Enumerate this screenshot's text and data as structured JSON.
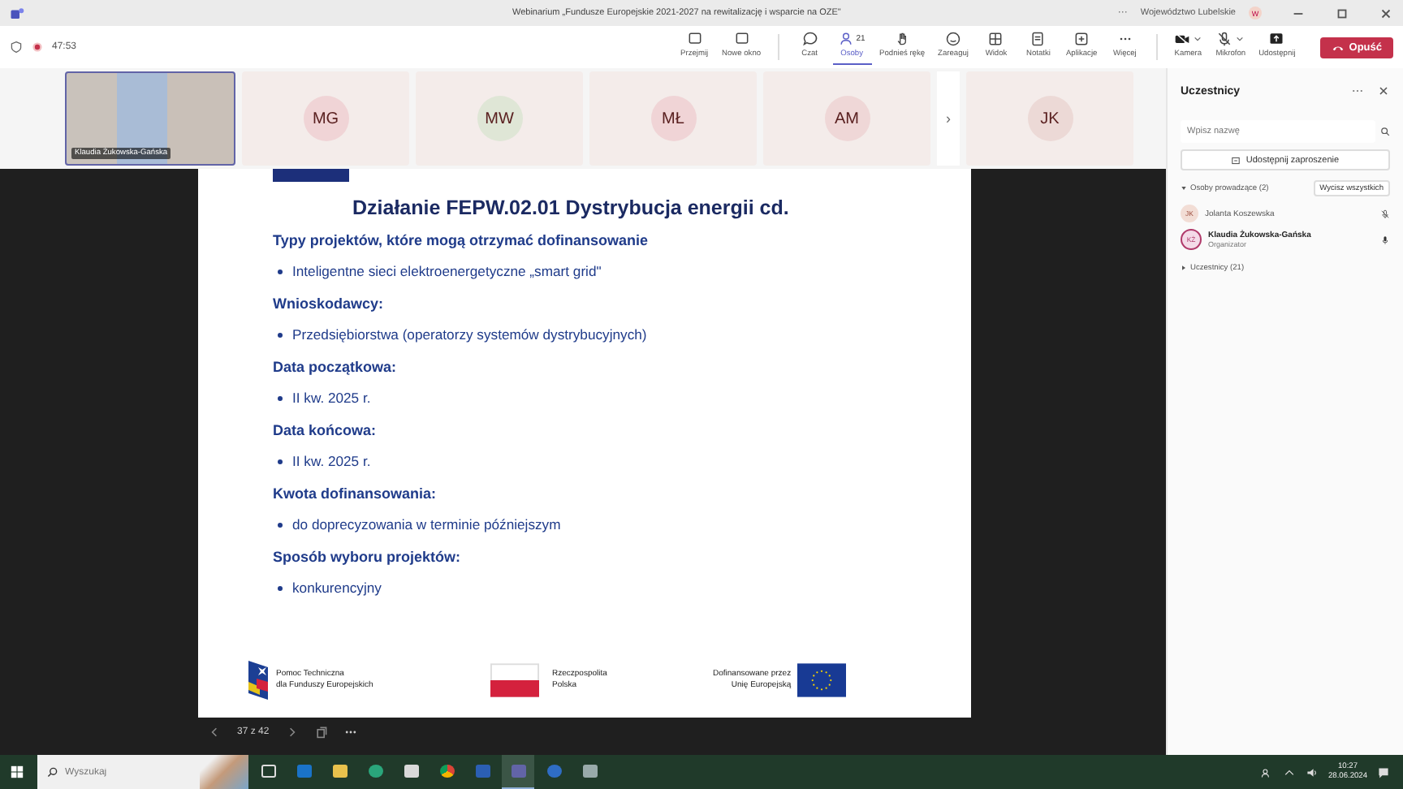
{
  "window": {
    "title": "Webinarium „Fundusze Europejskie 2021-2027 na rewitalizację i wsparcie na OZE\"",
    "more": "···",
    "organization": "Województwo Lubelskie",
    "user_initials": "W"
  },
  "meeting": {
    "timer": "47:53"
  },
  "toolbar": [
    {
      "kind": "tool",
      "label": "Przejmij",
      "selected": false
    },
    {
      "kind": "tool",
      "label": "Nowe okno",
      "selected": false
    },
    {
      "kind": "divider"
    },
    {
      "kind": "tool",
      "label": "Czat",
      "selected": false
    },
    {
      "kind": "tool",
      "label": "Osoby",
      "badge": "21",
      "selected": true
    },
    {
      "kind": "tool",
      "label": "Podnieś rękę",
      "selected": false
    },
    {
      "kind": "tool",
      "label": "Zareaguj",
      "selected": false
    },
    {
      "kind": "tool",
      "label": "Widok",
      "selected": false
    },
    {
      "kind": "tool",
      "label": "Notatki",
      "selected": false
    },
    {
      "kind": "tool",
      "label": "Aplikacje",
      "selected": false
    },
    {
      "kind": "tool",
      "label": "Więcej",
      "selected": false
    },
    {
      "kind": "divider"
    },
    {
      "kind": "device",
      "label": "Kamera",
      "selected": false
    },
    {
      "kind": "device",
      "label": "Mikrofon",
      "selected": false
    },
    {
      "kind": "tool",
      "label": "Udostępnij",
      "selected": false
    }
  ],
  "leave_button": "Opuść",
  "video_strip": [
    {
      "kind": "video",
      "name": "Klaudia Żukowska-Gańska"
    },
    {
      "kind": "avatar",
      "initials": "MG",
      "color": "#f0d4d6"
    },
    {
      "kind": "avatar",
      "initials": "MW",
      "color": "#dfe6d6"
    },
    {
      "kind": "avatar",
      "initials": "MŁ",
      "color": "#f0d4d6"
    },
    {
      "kind": "avatar",
      "initials": "AM",
      "color": "#efd7d7"
    },
    {
      "kind": "next",
      "glyph": "›"
    },
    {
      "kind": "avatar",
      "initials": "JK",
      "color": "#ecd9d6"
    }
  ],
  "slide": {
    "title": "Działanie FEPW.02.01 Dystrybucja energii cd.",
    "sections": [
      {
        "heading": "Typy projektów, które mogą otrzymać dofinansowanie",
        "items": [
          "Inteligentne sieci elektroenergetyczne „smart grid\""
        ]
      },
      {
        "heading": "Wnioskodawcy:",
        "items": [
          "Przedsiębiorstwa (operatorzy systemów dystrybucyjnych)"
        ]
      },
      {
        "heading": "Data początkowa:",
        "items": [
          "II kw. 2025 r."
        ]
      },
      {
        "heading": "Data końcowa:",
        "items": [
          "II kw. 2025 r."
        ]
      },
      {
        "heading": "Kwota dofinansowania:",
        "items": [
          "do doprecyzowania w terminie późniejszym"
        ]
      },
      {
        "heading": "Sposób wyboru projektów:",
        "items": [
          "konkurencyjny"
        ]
      }
    ],
    "logos": [
      {
        "kind": "fe",
        "lines": [
          "Pomoc Techniczna",
          "dla Funduszy Europejskich"
        ]
      },
      {
        "kind": "pl",
        "lines": [
          "Rzeczpospolita",
          "Polska"
        ]
      },
      {
        "kind": "eu",
        "lines": [
          "Dofinansowane przez",
          "Unię Europejską"
        ]
      }
    ]
  },
  "slide_nav": {
    "page": "37 z 42"
  },
  "participants_panel": {
    "title": "Uczestnicy",
    "search": {
      "placeholder": "Wpisz nazwę"
    },
    "invite_button": "Udostępnij zaproszenie",
    "groups": [
      {
        "label": "Osoby prowadzące (2)",
        "expanded": true,
        "action": "Wycisz wszystkich",
        "people": [
          {
            "initials": "JK",
            "name": "Jolanta Koszewska",
            "muted": true,
            "speaking": false
          },
          {
            "initials": "KŻ",
            "name": "Klaudia Żukowska-Gańska",
            "role": "Organizator",
            "muted": false,
            "speaking": true
          }
        ]
      },
      {
        "label": "Uczestnicy (21)",
        "expanded": false
      }
    ]
  },
  "taskbar": {
    "search": {
      "placeholder": "Wyszukaj"
    },
    "time": "10:27",
    "date": "28.06.2024"
  }
}
